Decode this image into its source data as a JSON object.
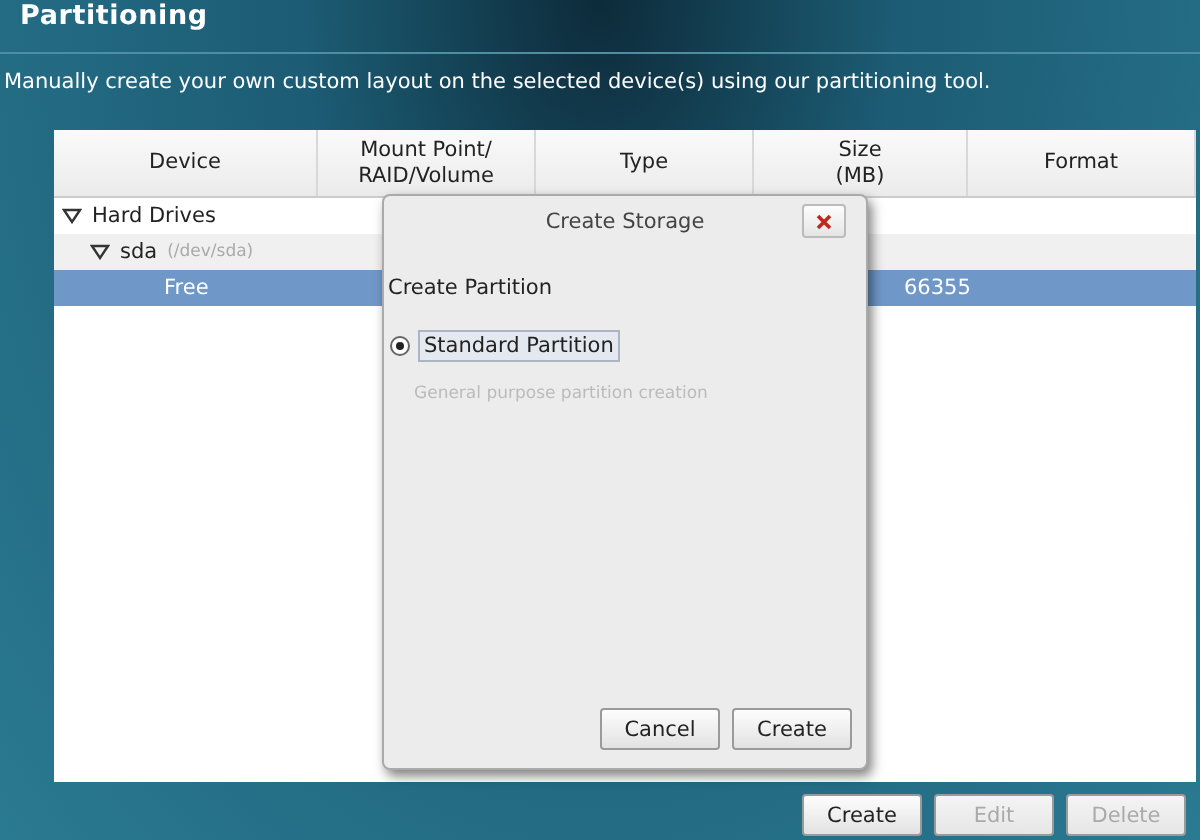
{
  "title": "Partitioning",
  "description": "Manually create your own custom layout on the selected device(s) using our partitioning tool.",
  "table": {
    "columns": [
      "Device",
      "Mount Point/\nRAID/Volume",
      "Type",
      "Size\n(MB)",
      "Format"
    ],
    "rows": [
      {
        "device": "Hard Drives",
        "expanded": true,
        "selected": false,
        "children": [
          {
            "device": "sda",
            "path": "(/dev/sda)",
            "expanded": true,
            "selected": false,
            "children": [
              {
                "device": "Free",
                "size": "66355",
                "selected": true
              }
            ]
          }
        ]
      }
    ]
  },
  "dialog": {
    "title": "Create Storage",
    "section": "Create Partition",
    "options": [
      {
        "label": "Standard Partition",
        "hint": "General purpose partition creation",
        "selected": true
      }
    ],
    "buttons": [
      "Cancel",
      "Create"
    ]
  },
  "buttons": [
    {
      "label": "Create",
      "disabled": false
    },
    {
      "label": "Edit",
      "disabled": true
    },
    {
      "label": "Delete",
      "disabled": true
    }
  ]
}
